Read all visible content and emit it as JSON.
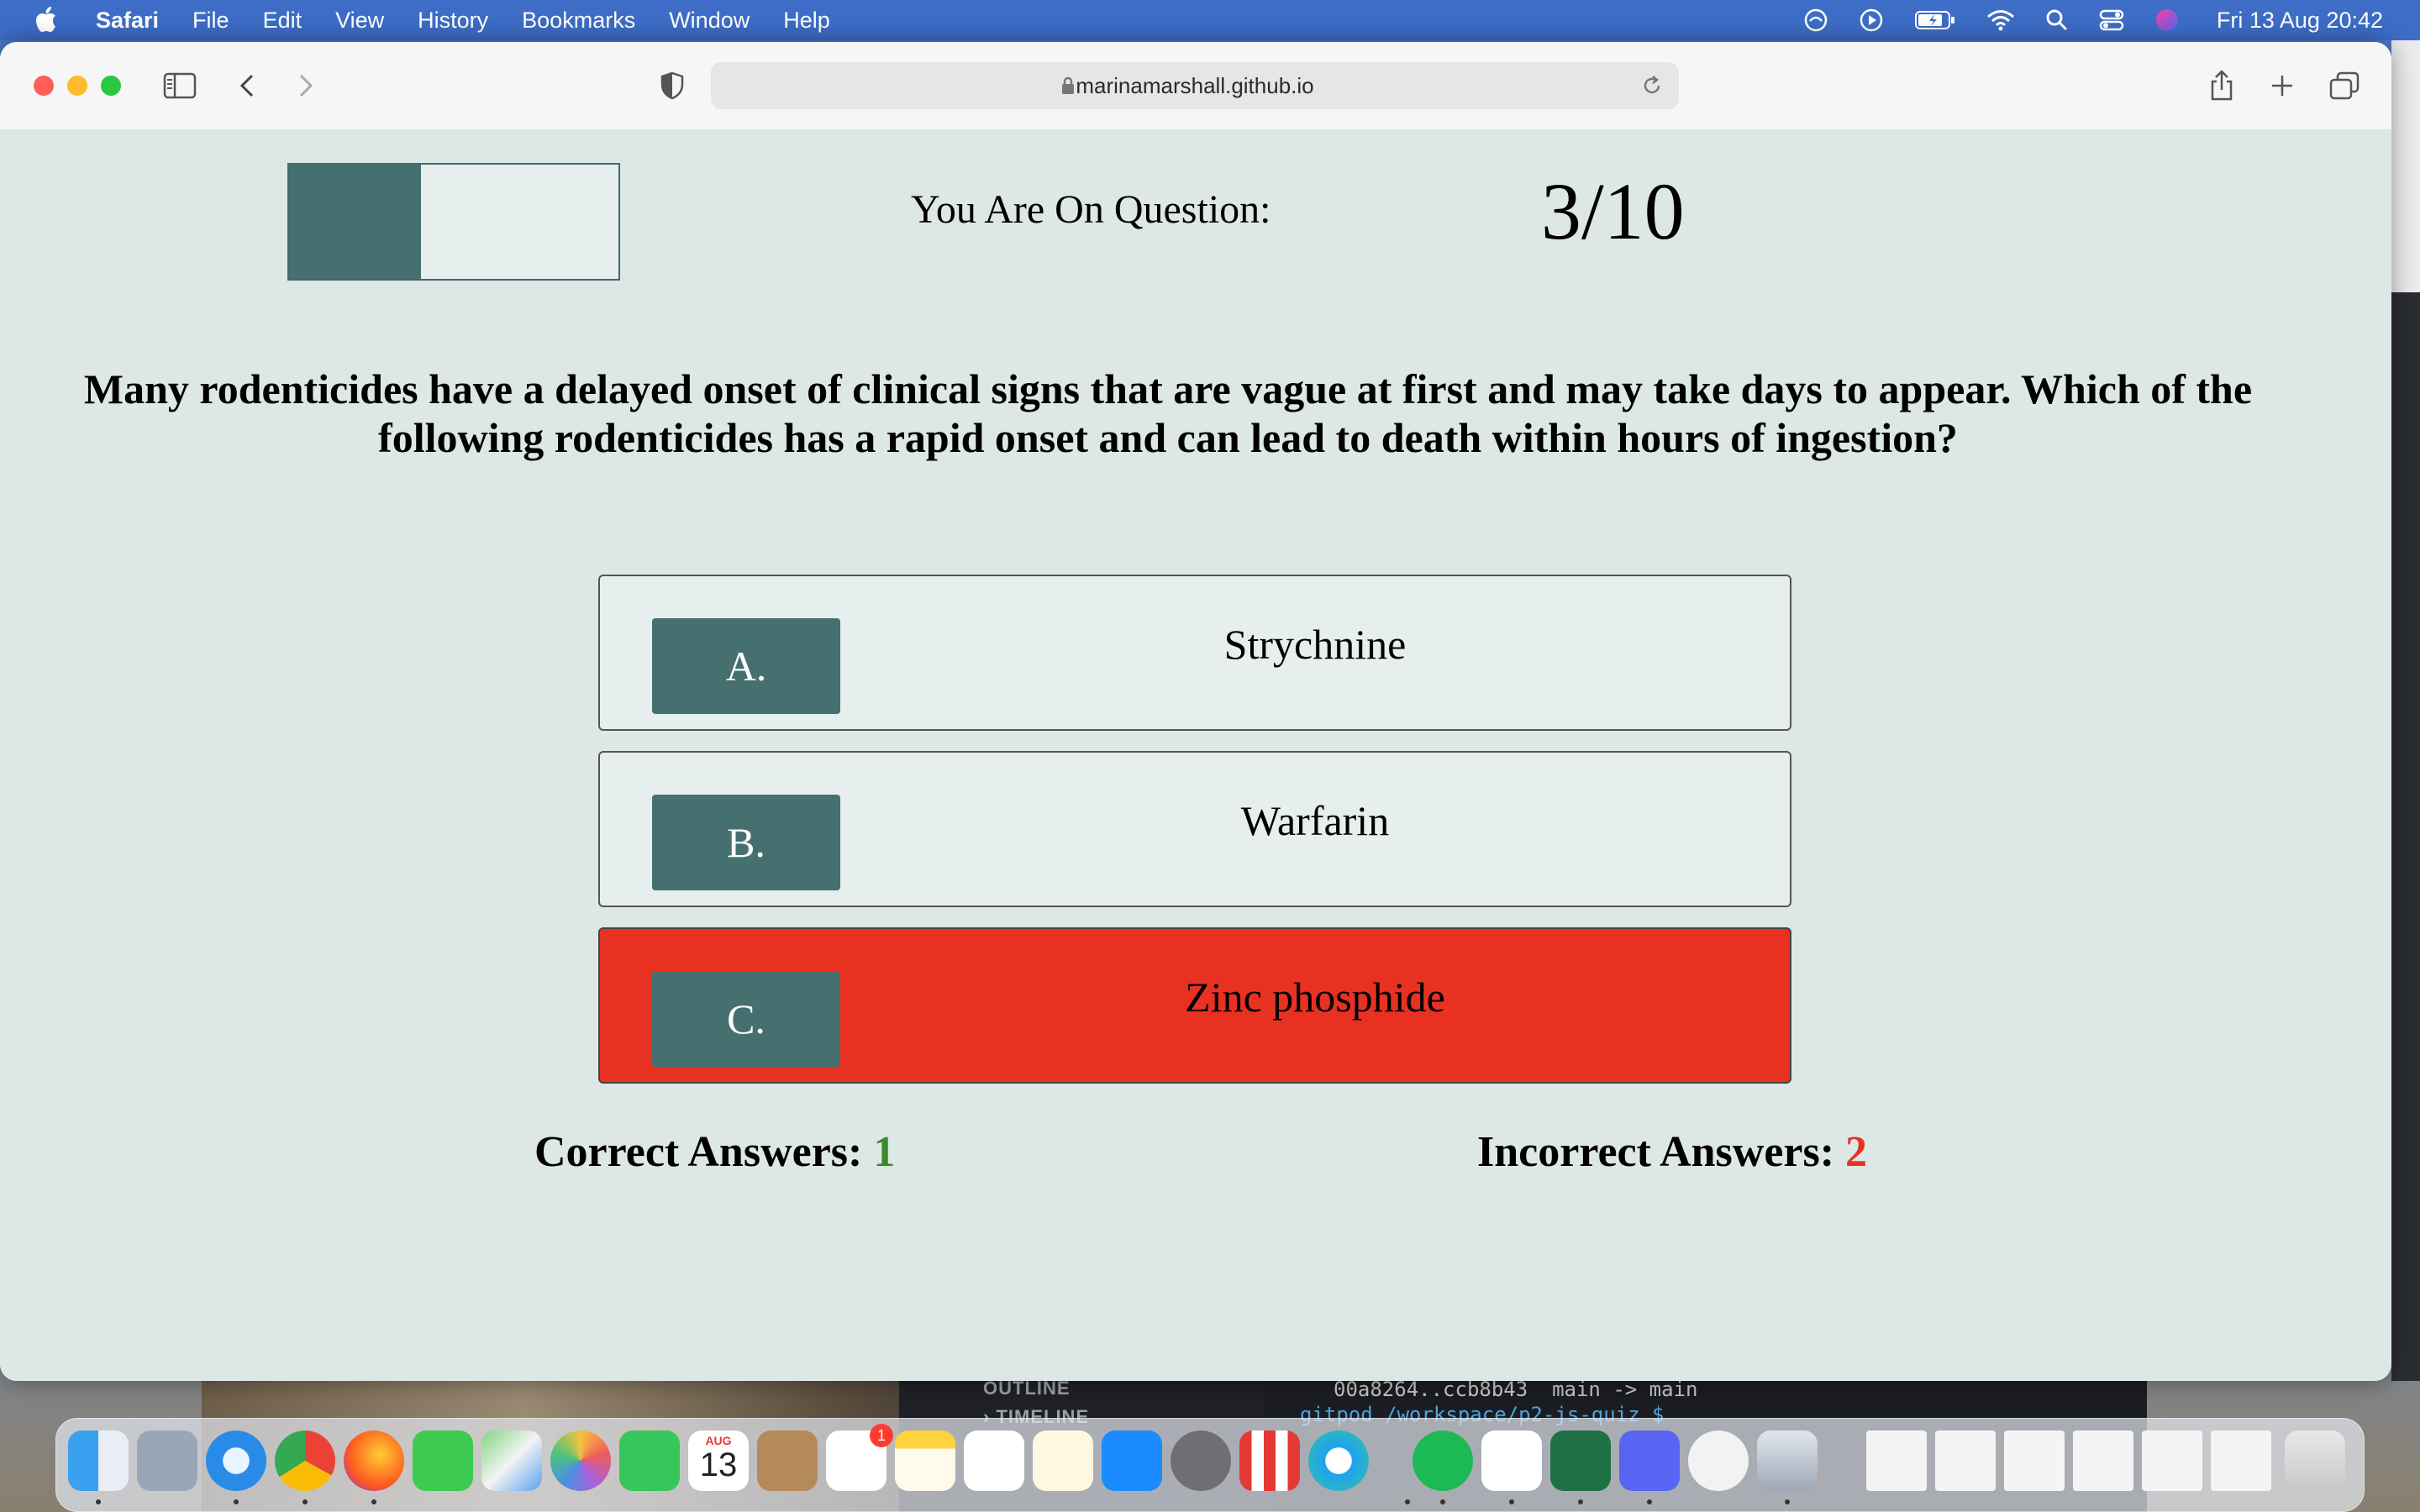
{
  "menubar": {
    "app_name": "Safari",
    "menus": [
      "File",
      "Edit",
      "View",
      "History",
      "Bookmarks",
      "Window",
      "Help"
    ],
    "clock": "Fri 13 Aug  20:42"
  },
  "browser": {
    "url": "marinamarshall.github.io"
  },
  "quiz": {
    "question_label": "You Are On Question:",
    "question_counter": "3/10",
    "progress_fraction": 0.4,
    "question_text": "Many rodenticides have a delayed onset of clinical signs that are vague at first and may take days to appear. Which of the following rodenticides has a rapid onset and can lead to death within hours of ingestion?",
    "answers": [
      {
        "letter": "A.",
        "text": "Strychnine",
        "state": "default"
      },
      {
        "letter": "B.",
        "text": "Warfarin",
        "state": "default"
      },
      {
        "letter": "C.",
        "text": "Zinc phosphide",
        "state": "selected-incorrect"
      }
    ],
    "score": {
      "correct_label": "Correct Answers:",
      "correct_value": "1",
      "incorrect_label": "Incorrect Answers:",
      "incorrect_value": "2"
    },
    "colors": {
      "page_bg": "#dde8e6",
      "accent_teal": "#467070",
      "incorrect_red": "#e93122",
      "correct_green": "#3a8a2a"
    }
  },
  "background": {
    "terminal_line_1": "00a8264..ccb8b43  main -> main",
    "terminal_line_2": "gitpod /workspace/p2-js-quiz $",
    "editor_outline": "OUTLINE",
    "editor_timeline": "TIMELINE"
  },
  "dock": {
    "calendar_month": "AUG",
    "calendar_day": "13",
    "reminders_badge": "1"
  }
}
